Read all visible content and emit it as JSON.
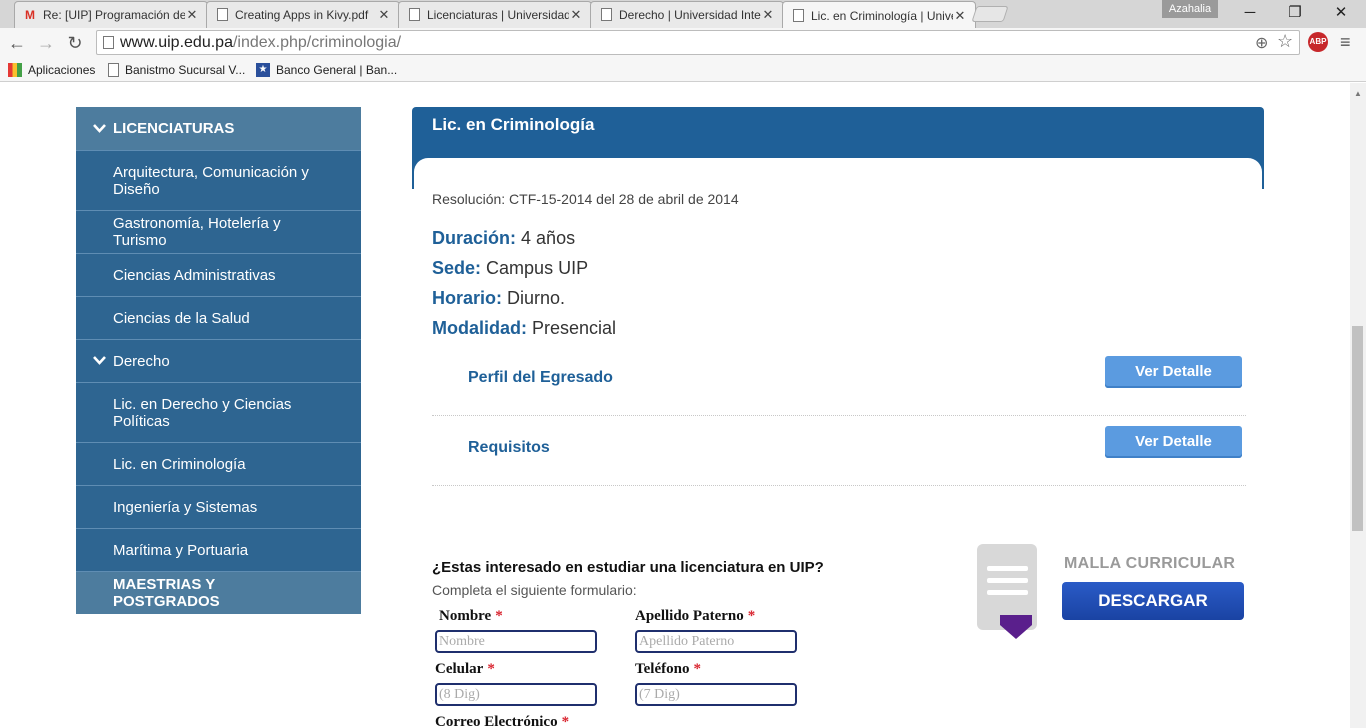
{
  "browser": {
    "tabs": [
      {
        "title": "Re: [UIP] Programación de",
        "icon": "gmail-icon"
      },
      {
        "title": "Creating Apps in Kivy.pdf",
        "icon": "page-icon"
      },
      {
        "title": "Licenciaturas | Universidad",
        "icon": "page-icon"
      },
      {
        "title": "Derecho | Universidad Inte",
        "icon": "page-icon"
      },
      {
        "title": "Lic. en Criminología | Unive",
        "icon": "page-icon",
        "active": true
      }
    ],
    "user": "Azahalia",
    "url_host": "www.uip.edu.pa",
    "url_path": "/index.php/criminologia/",
    "adblock_label": "ABP",
    "adblock_count": "2",
    "bookmarks": [
      "Aplicaciones",
      "Banistmo Sucursal V...",
      "Banco General | Ban..."
    ]
  },
  "sidebar": {
    "licenciaturas": "LICENCIATURAS",
    "items": [
      "Arquitectura, Comunicación y Diseño",
      "Gastronomía, Hotelería y Turismo",
      "Ciencias Administrativas",
      "Ciencias de la Salud"
    ],
    "derecho": "Derecho",
    "derecho_items": [
      "Lic. en Derecho y Ciencias Políticas",
      "Lic. en Criminología"
    ],
    "items2": [
      "Ingeniería y Sistemas",
      "Marítima y Portuaria"
    ],
    "maestrias": "MAESTRIAS Y POSTGRADOS"
  },
  "content": {
    "title": "Lic. en Criminología",
    "resolucion": "Resolución: CTF-15-2014 del 28 de abril de 2014",
    "facts": [
      {
        "key": "Duración:",
        "value": "4 años"
      },
      {
        "key": "Sede:",
        "value": "Campus UIP"
      },
      {
        "key": "Horario:",
        "value": "Diurno."
      },
      {
        "key": "Modalidad:",
        "value": "Presencial"
      }
    ],
    "sections": [
      {
        "title": "Perfil del Egresado",
        "button": "Ver Detalle"
      },
      {
        "title": "Requisitos",
        "button": "Ver Detalle"
      }
    ]
  },
  "form": {
    "question": "¿Estas interesado en estudiar una licenciatura en UIP?",
    "subtitle": "Completa el siguiente formulario:",
    "required_mark": "*",
    "fields": [
      {
        "label": "Nombre",
        "placeholder": "Nombre"
      },
      {
        "label": "Apellido Paterno",
        "placeholder": "Apellido Paterno"
      },
      {
        "label": "Celular",
        "placeholder": "(8 Dig)"
      },
      {
        "label": "Teléfono",
        "placeholder": "(7 Dig)"
      },
      {
        "label": "Correo Electrónico"
      }
    ]
  },
  "malla": {
    "title": "MALLA CURRICULAR",
    "button": "DESCARGAR"
  }
}
